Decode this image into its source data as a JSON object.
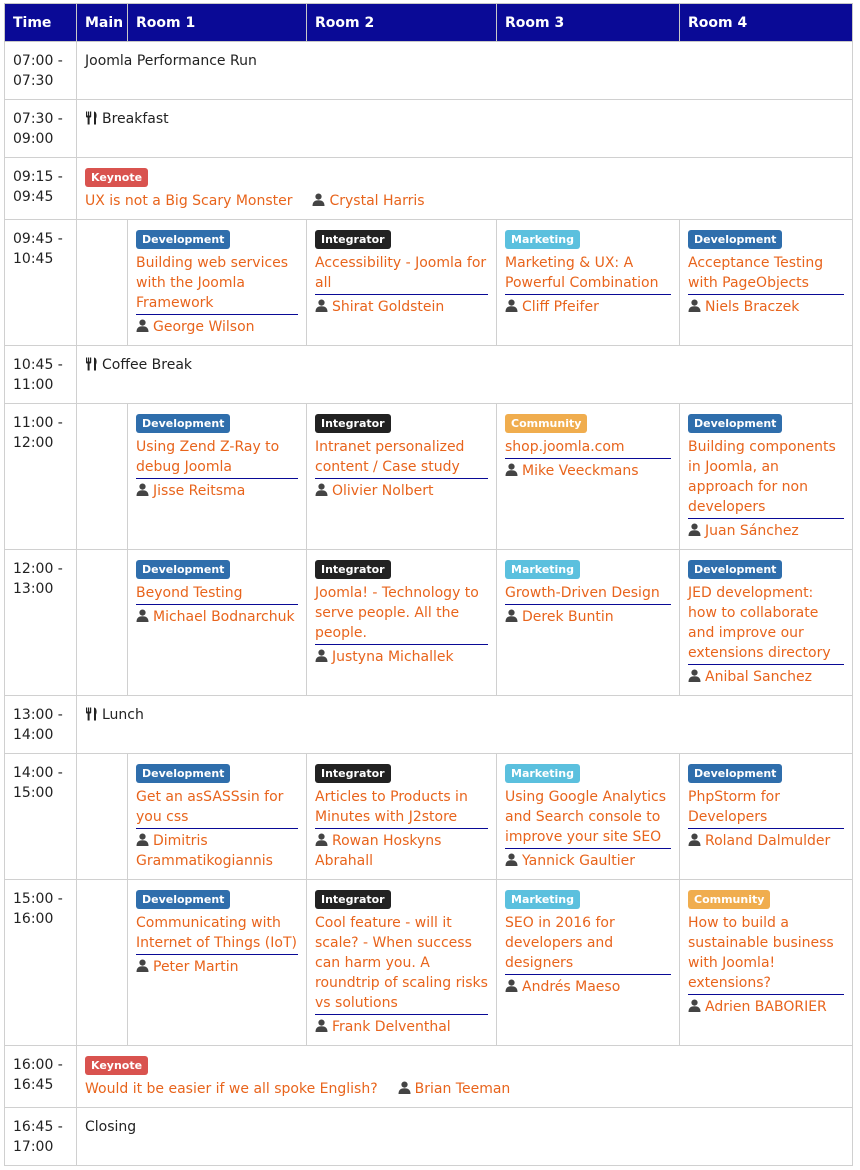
{
  "headers": [
    "Time",
    "Main",
    "Room 1",
    "Room 2",
    "Room 3",
    "Room 4"
  ],
  "colors": {
    "header_bg": "#0a0a96",
    "link": "#e8641c",
    "development": "#2f6eac",
    "integrator": "#222222",
    "marketing": "#5bc0de",
    "community": "#f0ad4e",
    "keynote": "#d9534f"
  },
  "rows": [
    {
      "time": [
        "07:00 -",
        "07:30"
      ],
      "main": {
        "kind": "text",
        "text": "Joomla Performance Run"
      }
    },
    {
      "time": [
        "07:30 -",
        "09:00"
      ],
      "main": {
        "kind": "break",
        "text": "Breakfast",
        "icon": "cutlery-icon"
      }
    },
    {
      "time": [
        "09:15 -",
        "09:45"
      ],
      "main": {
        "kind": "keynote",
        "badge": "Keynote",
        "title": "UX is not a Big Scary Monster",
        "speaker": "Crystal Harris"
      }
    },
    {
      "time": [
        "09:45 -",
        "10:45"
      ],
      "sessions": [
        {
          "badge": "Development",
          "title": "Building web services with the Joomla Framework",
          "speaker": "George Wilson"
        },
        {
          "badge": "Integrator",
          "title": "Accessibility - Joomla for all",
          "speaker": "Shirat Goldstein"
        },
        {
          "badge": "Marketing",
          "title": "Marketing & UX: A Powerful Combination",
          "speaker": "Cliff Pfeifer"
        },
        {
          "badge": "Development",
          "title": "Acceptance Testing with PageObjects",
          "speaker": "Niels Braczek"
        }
      ]
    },
    {
      "time": [
        "10:45 -",
        "11:00"
      ],
      "main": {
        "kind": "break",
        "text": "Coffee Break",
        "icon": "cutlery-icon"
      }
    },
    {
      "time": [
        "11:00 -",
        "12:00"
      ],
      "sessions": [
        {
          "badge": "Development",
          "title": "Using Zend Z-Ray to debug Joomla",
          "speaker": "Jisse Reitsma"
        },
        {
          "badge": "Integrator",
          "title": "Intranet personalized content / Case study",
          "speaker": "Olivier Nolbert"
        },
        {
          "badge": "Community",
          "title": "shop.joomla.com",
          "speaker": "Mike Veeckmans"
        },
        {
          "badge": "Development",
          "title": "Building components in Joomla, an approach for non developers",
          "speaker": "Juan Sánchez"
        }
      ]
    },
    {
      "time": [
        "12:00 -",
        "13:00"
      ],
      "sessions": [
        {
          "badge": "Development",
          "title": "Beyond Testing",
          "speaker": "Michael Bodnarchuk"
        },
        {
          "badge": "Integrator",
          "title": "Joomla! - Technology to serve people. All the people.",
          "speaker": "Justyna Michallek"
        },
        {
          "badge": "Marketing",
          "title": "Growth-Driven Design",
          "speaker": "Derek Buntin"
        },
        {
          "badge": "Development",
          "title": "JED development: how to collaborate and improve our extensions directory",
          "speaker": "Anibal Sanchez"
        }
      ]
    },
    {
      "time": [
        "13:00 -",
        "14:00"
      ],
      "main": {
        "kind": "break",
        "text": "Lunch",
        "icon": "cutlery-icon"
      }
    },
    {
      "time": [
        "14:00 -",
        "15:00"
      ],
      "sessions": [
        {
          "badge": "Development",
          "title": "Get an asSASSsin for you css",
          "speaker": "Dimitris Grammatikogiannis"
        },
        {
          "badge": "Integrator",
          "title": "Articles to Products in Minutes with J2store",
          "speaker": "Rowan Hoskyns Abrahall"
        },
        {
          "badge": "Marketing",
          "title": "Using Google Analytics and Search console to improve your site SEO",
          "speaker": "Yannick Gaultier"
        },
        {
          "badge": "Development",
          "title": "PhpStorm for Developers",
          "speaker": "Roland Dalmulder"
        }
      ]
    },
    {
      "time": [
        "15:00 -",
        "16:00"
      ],
      "sessions": [
        {
          "badge": "Development",
          "title": "Communicating with Internet of Things (IoT)",
          "speaker": "Peter Martin"
        },
        {
          "badge": "Integrator",
          "title": "Cool feature - will it scale? - When success can harm you. A roundtrip of scaling risks vs solutions",
          "speaker": "Frank Delventhal"
        },
        {
          "badge": "Marketing",
          "title": "SEO in 2016 for developers and designers",
          "speaker": "Andrés Maeso"
        },
        {
          "badge": "Community",
          "title": "How to build a sustainable business with Joomla! extensions?",
          "speaker": "Adrien BABORIER"
        }
      ]
    },
    {
      "time": [
        "16:00 -",
        "16:45"
      ],
      "main": {
        "kind": "keynote",
        "badge": "Keynote",
        "title": "Would it be easier if we all spoke English?",
        "speaker": "Brian Teeman"
      }
    },
    {
      "time": [
        "16:45 -",
        "17:00"
      ],
      "main": {
        "kind": "text",
        "text": "Closing"
      }
    }
  ]
}
